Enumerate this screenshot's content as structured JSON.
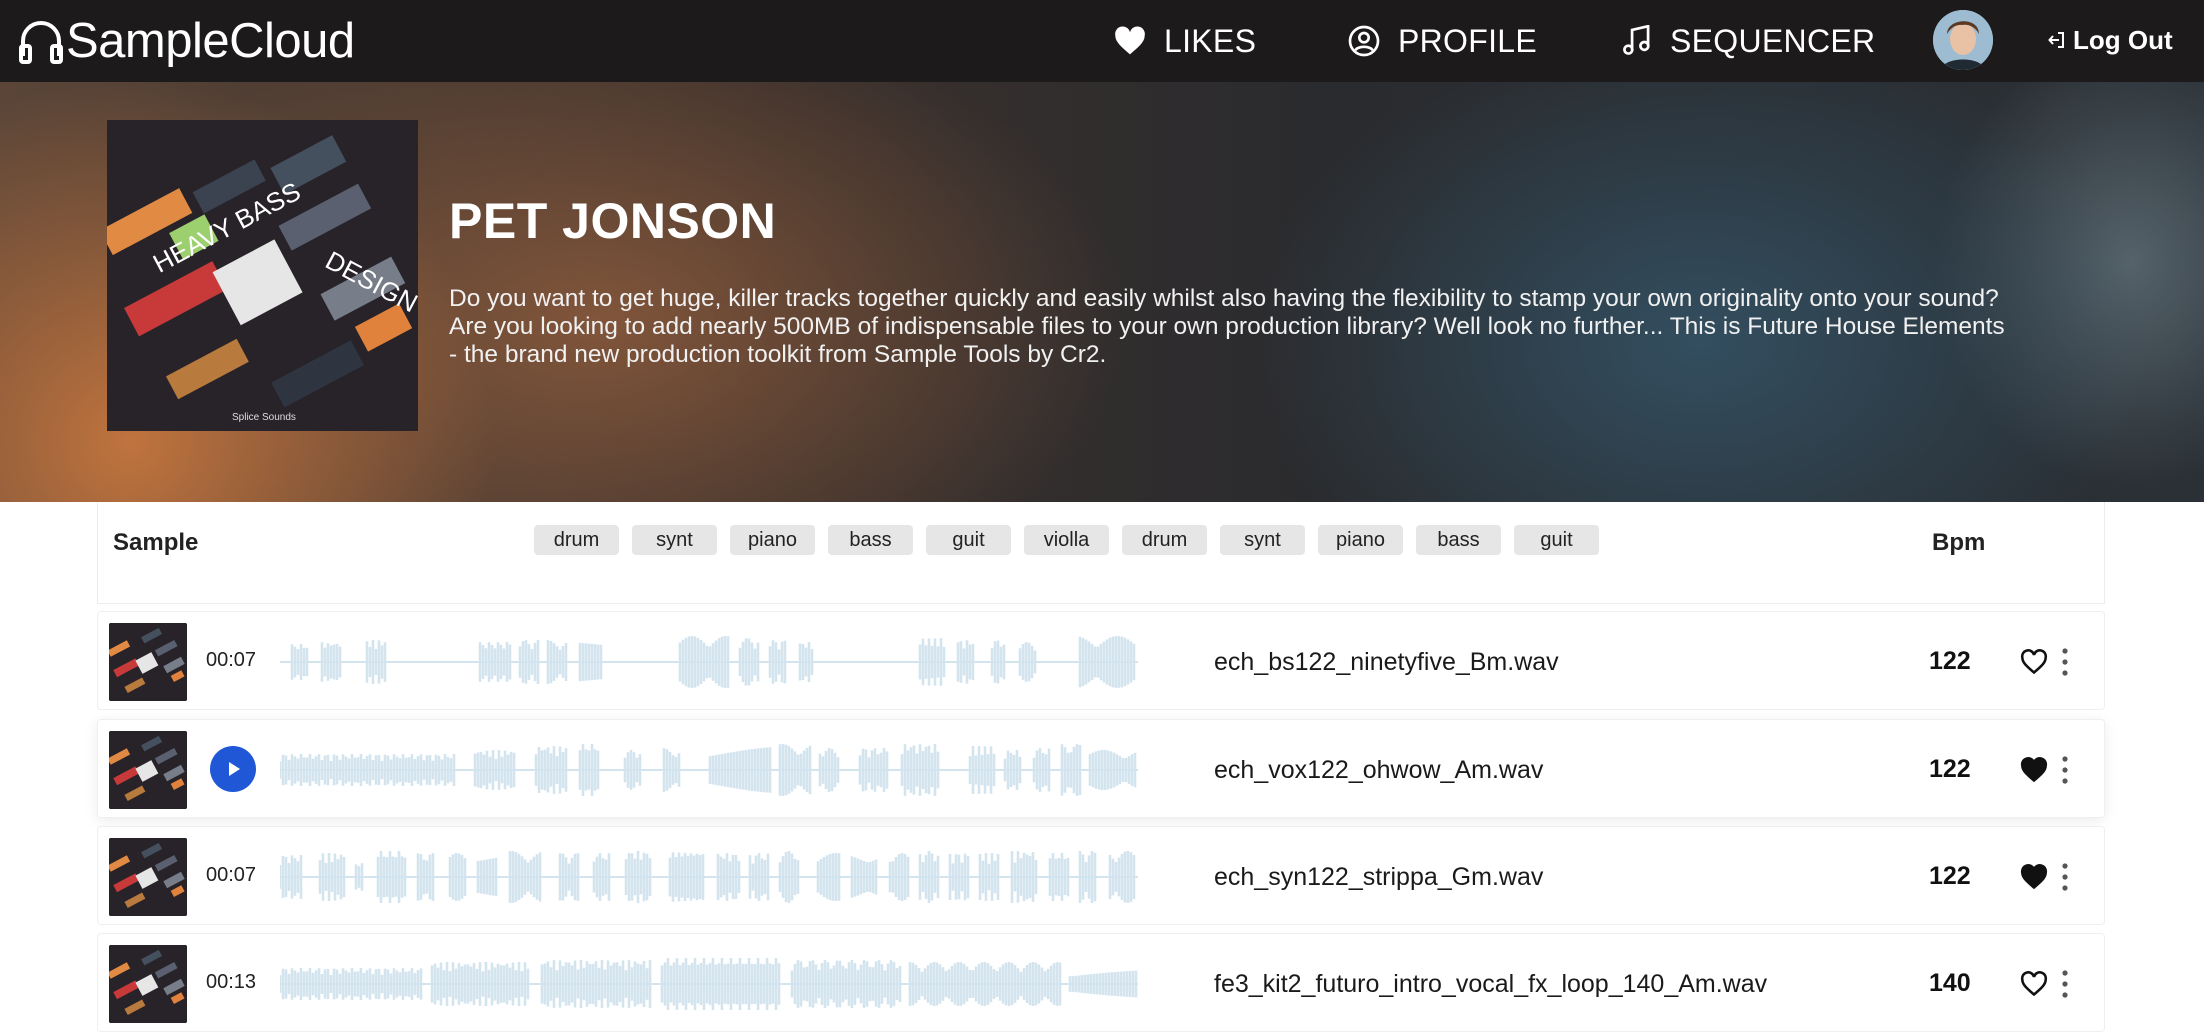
{
  "nav": {
    "logo": "SampleCloud",
    "likes": "LIKES",
    "profile": "PROFILE",
    "sequencer": "SEQUENCER",
    "logout": "Log Out"
  },
  "hero": {
    "title": "PET JONSON",
    "description": "Do you want to get huge, killer tracks together quickly and easily whilst also having the flexibility to stamp your own originality onto your sound? Are you looking to add nearly 500MB of indispensable files to your own production library? Well look no further... This is Future House Elements - the brand new production toolkit from Sample Tools by Cr2.",
    "cover_text": [
      "HEAVY BASS",
      "DESIGN",
      "Splice Sounds"
    ]
  },
  "table": {
    "sample_header": "Sample",
    "bpm_header": "Bpm",
    "tags": [
      "drum",
      "synt",
      "piano",
      "bass",
      "guit",
      "violla",
      "drum",
      "synt",
      "piano",
      "bass",
      "guit"
    ]
  },
  "rows": [
    {
      "duration": "00:07",
      "filename": "ech_bs122_ninetyfive_Bm.wav",
      "bpm": "122",
      "liked": false,
      "playing": false
    },
    {
      "duration": "",
      "filename": "ech_vox122_ohwow_Am.wav",
      "bpm": "122",
      "liked": true,
      "playing": true
    },
    {
      "duration": "00:07",
      "filename": "ech_syn122_strippa_Gm.wav",
      "bpm": "122",
      "liked": true,
      "playing": false
    },
    {
      "duration": "00:13",
      "filename": "fe3_kit2_futuro_intro_vocal_fx_loop_140_Am.wav",
      "bpm": "140",
      "liked": false,
      "playing": false
    }
  ],
  "colors": {
    "nav_bg": "#1c1a1a",
    "accent_play": "#1f57d6",
    "waveform": "#d3e4ef",
    "chip_bg": "#e6e6e6"
  },
  "icons": [
    "headphones-icon",
    "heart-icon",
    "user-circle-icon",
    "music-note-icon",
    "logout-icon",
    "play-icon",
    "heart-outline-icon",
    "heart-filled-icon",
    "more-vertical-icon"
  ]
}
